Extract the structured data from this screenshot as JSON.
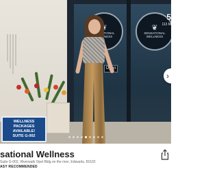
{
  "listing": {
    "title": "sational Wellness",
    "address": "Suite G-002, Riverwalk Opel Bldg on the river, Edwards, 81632",
    "badge": "ASY RECOMMENDED",
    "badge_extra": ""
  },
  "gallery": {
    "counter": "5",
    "counter_sub": "113 M",
    "slides_total": 9,
    "active_slide": 4,
    "icons": {
      "next": "chevron-right-icon",
      "share": "share-icon"
    }
  },
  "photo_text": {
    "wellness_sign_line1": "WELLNESS PACKAGES",
    "wellness_sign_line2": "AVAILABLE!",
    "wellness_sign_line3": "SUITE G-002",
    "storefront_sign_left": "SENSATIONAL WELLNESS",
    "storefront_sign_right": "SENSATIONAL WELLNESS",
    "open_sign": "Open"
  },
  "colors": {
    "accent": "#1a4a8a",
    "title_text": "#1b1b1b"
  }
}
